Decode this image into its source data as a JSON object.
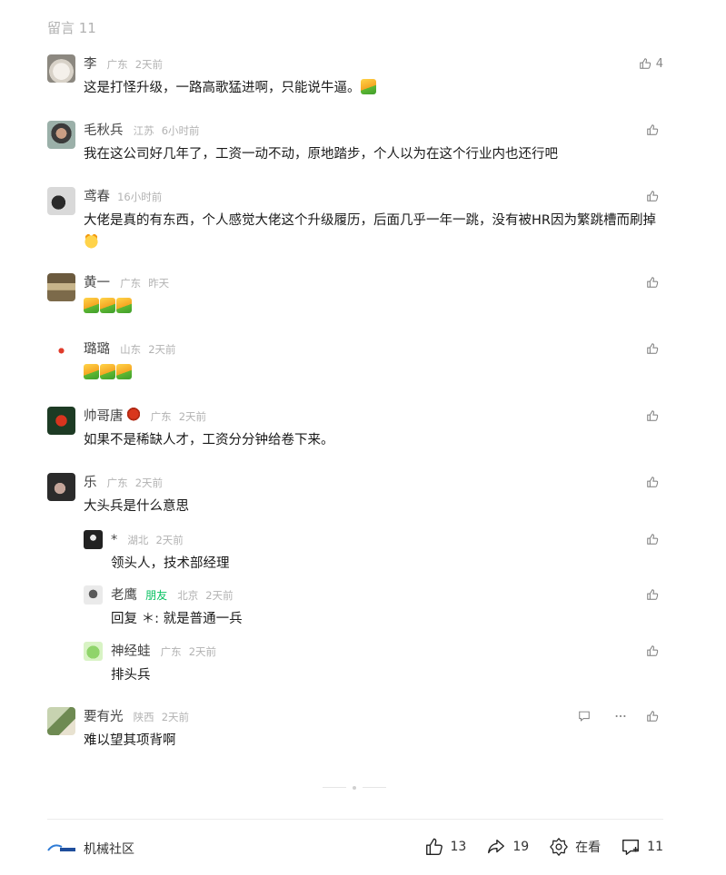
{
  "header": {
    "title": "留言 11"
  },
  "comments": [
    {
      "author": "李",
      "location": "广东",
      "time": "2天前",
      "text": "这是打怪升级，一路高歌猛进啊，只能说牛逼。",
      "likes": "4"
    },
    {
      "author": "毛秋兵",
      "location": "江苏",
      "time": "6小时前",
      "text": "我在这公司好几年了，工资一动不动，原地踏步，个人以为在这个行业内也还行吧",
      "likes": ""
    },
    {
      "author": "鸢春",
      "location": "",
      "time": "16小时前",
      "text": "大佬是真的有东西，个人感觉大佬这个升级履历，后面几乎一年一跳，没有被HR因为繁跳槽而刷掉",
      "likes": ""
    },
    {
      "author": "黄一",
      "location": "广东",
      "time": "昨天",
      "text": "",
      "likes": ""
    },
    {
      "author": "璐璐",
      "location": "山东",
      "time": "2天前",
      "text": "",
      "likes": ""
    },
    {
      "author": "帅哥唐",
      "location": "广东",
      "time": "2天前",
      "text": "如果不是稀缺人才，工资分分钟给卷下来。",
      "likes": ""
    },
    {
      "author": "乐",
      "location": "广东",
      "time": "2天前",
      "text": "大头兵是什么意思",
      "likes": ""
    },
    {
      "author": "*",
      "location": "湖北",
      "time": "2天前",
      "text": "领头人，技术部经理",
      "likes": ""
    },
    {
      "author": "老鹰",
      "friend_tag": "朋友",
      "location": "北京",
      "time": "2天前",
      "text": "回复 ＊: 就是普通一兵",
      "likes": ""
    },
    {
      "author": "神经蛙",
      "location": "广东",
      "time": "2天前",
      "text": "排头兵",
      "likes": ""
    },
    {
      "author": "要有光",
      "location": "陕西",
      "time": "2天前",
      "text": "难以望其项背啊",
      "likes": ""
    }
  ],
  "footer": {
    "brand": "机械社区",
    "like_count": "13",
    "share_count": "19",
    "watching_label": "在看",
    "comment_count": "11"
  },
  "colors": {
    "meta": "#b2b2b2",
    "friend_tag": "#07c160",
    "text": "#1a1a1a"
  }
}
